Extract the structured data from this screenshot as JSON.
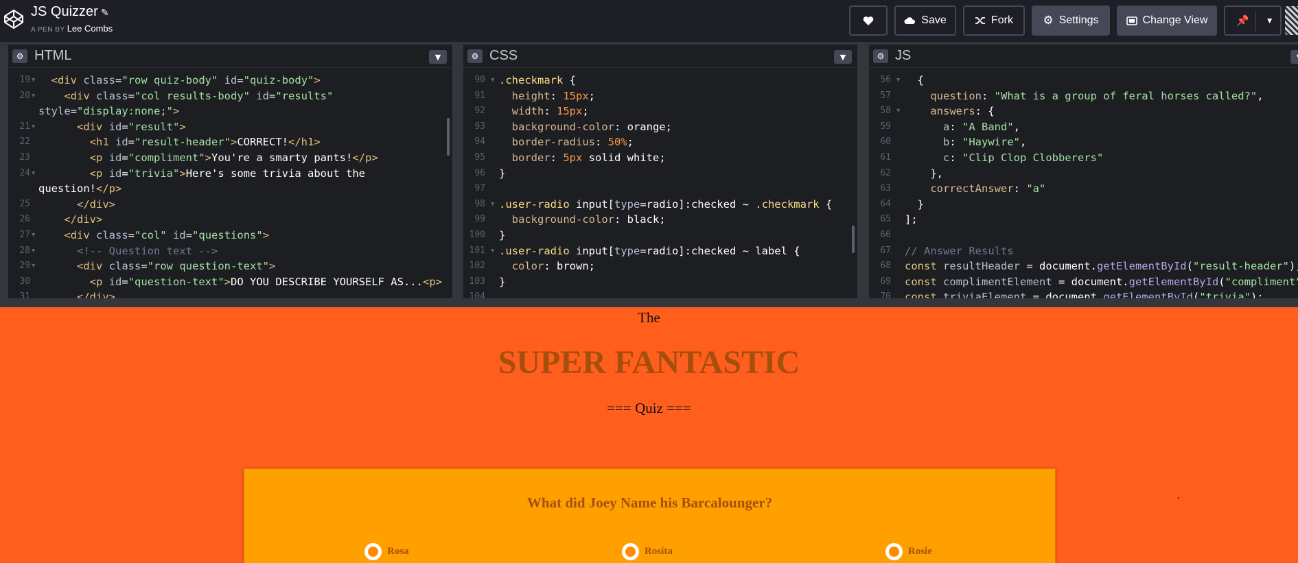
{
  "header": {
    "title": "JS Quizzer",
    "byline_prefix": "A PEN BY",
    "author": "Lee Combs",
    "buttons": {
      "save": "Save",
      "fork": "Fork",
      "settings": "Settings",
      "change_view": "Change View"
    },
    "icons": [
      "codepen-logo",
      "pencil-icon",
      "heart-icon",
      "cloud-icon",
      "fork-icon",
      "gear-icon",
      "layout-icon",
      "pin-icon",
      "chevron-down-icon"
    ]
  },
  "editors": {
    "html": {
      "title": "HTML",
      "lines": [
        {
          "n": "19",
          "fold": true,
          "html": "  <span class='t-tag'>&lt;div</span> <span class='t-attr'>class</span>=<span class='t-str'>\"row quiz-body\"</span> <span class='t-attr'>id</span>=<span class='t-str'>\"quiz-body\"</span><span class='t-tag'>&gt;</span>"
        },
        {
          "n": "20",
          "fold": true,
          "html": "    <span class='t-tag'>&lt;div</span> <span class='t-attr'>class</span>=<span class='t-str'>\"col results-body\"</span> <span class='t-attr'>id</span>=<span class='t-str'>\"results\"</span>"
        },
        {
          "n": "",
          "fold": false,
          "html": "<span class='t-attr'>style</span>=<span class='t-str'>\"display:none;\"</span><span class='t-tag'>&gt;</span>"
        },
        {
          "n": "21",
          "fold": true,
          "html": "      <span class='t-tag'>&lt;div</span> <span class='t-attr'>id</span>=<span class='t-str'>\"result\"</span><span class='t-tag'>&gt;</span>"
        },
        {
          "n": "22",
          "fold": false,
          "html": "        <span class='t-tag'>&lt;h1</span> <span class='t-attr'>id</span>=<span class='t-str'>\"result-header\"</span><span class='t-tag'>&gt;</span>CORRECT!<span class='t-tag'>&lt;/h1&gt;</span>"
        },
        {
          "n": "23",
          "fold": false,
          "html": "        <span class='t-tag'>&lt;p</span> <span class='t-attr'>id</span>=<span class='t-str'>\"compliment\"</span><span class='t-tag'>&gt;</span>You're a smarty pants!<span class='t-tag'>&lt;/p&gt;</span>"
        },
        {
          "n": "24",
          "fold": true,
          "html": "        <span class='t-tag'>&lt;p</span> <span class='t-attr'>id</span>=<span class='t-str'>\"trivia\"</span><span class='t-tag'>&gt;</span>Here's some trivia about the"
        },
        {
          "n": "",
          "fold": false,
          "html": "question!<span class='t-tag'>&lt;/p&gt;</span>"
        },
        {
          "n": "25",
          "fold": false,
          "html": "      <span class='t-tag'>&lt;/div&gt;</span>"
        },
        {
          "n": "26",
          "fold": false,
          "html": "    <span class='t-tag'>&lt;/div&gt;</span>"
        },
        {
          "n": "27",
          "fold": true,
          "html": "    <span class='t-tag'>&lt;div</span> <span class='t-attr'>class</span>=<span class='t-str'>\"col\"</span> <span class='t-attr'>id</span>=<span class='t-str'>\"questions\"</span><span class='t-tag'>&gt;</span>"
        },
        {
          "n": "28",
          "fold": true,
          "html": "      <span class='t-com'>&lt;!-- Question text --&gt;</span>"
        },
        {
          "n": "29",
          "fold": true,
          "html": "      <span class='t-tag'>&lt;div</span> <span class='t-attr'>class</span>=<span class='t-str'>\"row question-text\"</span><span class='t-tag'>&gt;</span>"
        },
        {
          "n": "30",
          "fold": false,
          "html": "        <span class='t-tag'>&lt;p</span> <span class='t-attr'>id</span>=<span class='t-str'>\"question-text\"</span><span class='t-tag'>&gt;</span>DO YOU DESCRIBE YOURSELF AS...<span class='t-tag'>&lt;p&gt;</span>"
        },
        {
          "n": "31",
          "fold": false,
          "html": "      <span class='t-tag'>&lt;/div&gt;</span>"
        }
      ]
    },
    "css": {
      "title": "CSS",
      "lines": [
        {
          "n": "90",
          "fold": true,
          "html": "<span class='t-sel'>.checkmark</span> {"
        },
        {
          "n": "91",
          "fold": false,
          "html": "  <span class='t-prop'>height</span>: <span class='t-num'>15px</span>;"
        },
        {
          "n": "92",
          "fold": false,
          "html": "  <span class='t-prop'>width</span>: <span class='t-num'>15px</span>;"
        },
        {
          "n": "93",
          "fold": false,
          "html": "  <span class='t-prop'>background-color</span>: orange;"
        },
        {
          "n": "94",
          "fold": false,
          "html": "  <span class='t-prop'>border-radius</span>: <span class='t-num'>50%</span>;"
        },
        {
          "n": "95",
          "fold": false,
          "html": "  <span class='t-prop'>border</span>: <span class='t-num'>5px</span> solid white;"
        },
        {
          "n": "96",
          "fold": false,
          "html": "}"
        },
        {
          "n": "97",
          "fold": false,
          "html": ""
        },
        {
          "n": "98",
          "fold": true,
          "html": "<span class='t-sel'>.user-radio</span> input[<span class='t-attr'>type</span>=radio]:checked ~ <span class='t-sel'>.checkmark</span> {"
        },
        {
          "n": "99",
          "fold": false,
          "html": "  <span class='t-prop'>background-color</span>: black;"
        },
        {
          "n": "100",
          "fold": false,
          "html": "}"
        },
        {
          "n": "101",
          "fold": true,
          "html": "<span class='t-sel'>.user-radio</span> input[<span class='t-attr'>type</span>=radio]:checked ~ label {"
        },
        {
          "n": "102",
          "fold": false,
          "html": "  <span class='t-prop'>color</span>: brown;"
        },
        {
          "n": "103",
          "fold": false,
          "html": "}"
        },
        {
          "n": "104",
          "fold": false,
          "html": ""
        }
      ]
    },
    "js": {
      "title": "JS",
      "lines": [
        {
          "n": "56",
          "fold": true,
          "html": "  {"
        },
        {
          "n": "57",
          "fold": false,
          "html": "    <span class='t-prop'>question</span>: <span class='t-str'>\"What is a group of feral horses called?\"</span>,"
        },
        {
          "n": "58",
          "fold": true,
          "html": "    <span class='t-prop'>answers</span>: {"
        },
        {
          "n": "59",
          "fold": false,
          "html": "      <span class='t-attr'>a</span>: <span class='t-str'>\"A Band\"</span>,"
        },
        {
          "n": "60",
          "fold": false,
          "html": "      <span class='t-attr'>b</span>: <span class='t-str'>\"Haywire\"</span>,"
        },
        {
          "n": "61",
          "fold": false,
          "html": "      <span class='t-attr'>c</span>: <span class='t-str'>\"Clip Clop Clobberers\"</span>"
        },
        {
          "n": "62",
          "fold": false,
          "html": "    },"
        },
        {
          "n": "63",
          "fold": false,
          "html": "    <span class='t-prop'>correctAnswer</span>: <span class='t-str'>\"a\"</span>"
        },
        {
          "n": "64",
          "fold": false,
          "html": "  }"
        },
        {
          "n": "65",
          "fold": false,
          "html": "];"
        },
        {
          "n": "66",
          "fold": false,
          "html": ""
        },
        {
          "n": "67",
          "fold": false,
          "html": "<span class='t-com'>// Answer Results</span>"
        },
        {
          "n": "68",
          "fold": false,
          "html": "<span class='t-kw'>const</span> <span class='t-attr'>resultHeader</span> = document.<span class='t-fn'>getElementById</span>(<span class='t-str'>\"result-header\"</span>);"
        },
        {
          "n": "69",
          "fold": false,
          "html": "<span class='t-kw'>const</span> <span class='t-attr'>complimentElement</span> = document.<span class='t-fn'>getElementById</span>(<span class='t-str'>\"compliment\"</span>);"
        },
        {
          "n": "70",
          "fold": false,
          "html": "<span class='t-kw'>const</span> <span class='t-attr'>triviaElement</span> = document.<span class='t-fn'>getElementById</span>(<span class='t-str'>\"trivia\"</span>);"
        }
      ]
    }
  },
  "preview": {
    "pre_title": "The",
    "title": "SUPER FANTASTIC",
    "subtitle": "=== Quiz ===",
    "question": "What did Joey Name his Barcalounger?",
    "answers": [
      "Rosa",
      "Rosita",
      "Rosie"
    ],
    "colors": {
      "background": "#ff5e1c",
      "card": "#ffa000",
      "title": "#a54f0d"
    }
  }
}
